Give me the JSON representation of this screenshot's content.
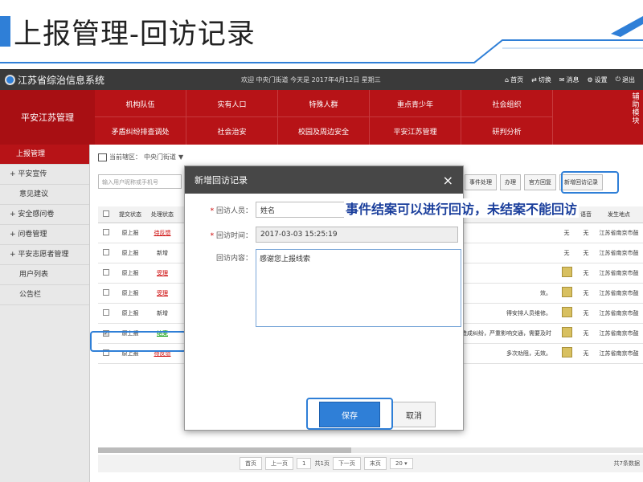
{
  "slide": {
    "title": "上报管理-回访记录",
    "annotation": "事件结案可以进行回访，未结案不能回访"
  },
  "topbar": {
    "logo": "江苏省综治信息系统",
    "welcome": "欢迎 中央门街道 今天是 2017年4月12日 星期三",
    "links": [
      {
        "icon": "home-icon",
        "label": "首页"
      },
      {
        "icon": "switch-icon",
        "label": "切换"
      },
      {
        "icon": "mail-icon",
        "label": "消息"
      },
      {
        "icon": "gear-icon",
        "label": "设置"
      },
      {
        "icon": "power-icon",
        "label": "退出"
      }
    ]
  },
  "nav": {
    "current": "平安江苏管理",
    "row1": [
      "机构队伍",
      "实有人口",
      "特殊人群",
      "重点青少年",
      "社会组织"
    ],
    "row2": [
      "矛盾纠纷排查调处",
      "社会治安",
      "校园及周边安全",
      "平安江苏管理",
      "研判分析"
    ],
    "side_module": "辅助模块"
  },
  "sidebar": {
    "items": [
      {
        "label": "上报管理",
        "active": true
      },
      {
        "label": "+ 平安宣传"
      },
      {
        "label": "意见建议",
        "sub": true
      },
      {
        "label": "+ 安全感问卷"
      },
      {
        "label": "+ 问卷管理"
      },
      {
        "label": "+ 平安志愿者管理"
      },
      {
        "label": "用户列表",
        "sub": true
      },
      {
        "label": "公告栏",
        "sub": true
      }
    ]
  },
  "main": {
    "crumb_prefix": "当前辖区：",
    "crumb_value": "中央门街道",
    "search_placeholder": "输入用户昵称或手机号",
    "actions": [
      "事件处理",
      "办理",
      "官方回复",
      "新增回访记录"
    ],
    "columns": [
      "",
      "提交状态",
      "处理状态",
      "图片",
      "语音",
      "发生地点"
    ],
    "rows": [
      {
        "submit": "原上报",
        "status": "待反馈",
        "status_type": "link",
        "desc": "",
        "pic": "无",
        "voice": "无",
        "place": "江苏省南京市鼓"
      },
      {
        "submit": "原上报",
        "status": "新增",
        "status_type": "plain",
        "desc": "",
        "pic": "无",
        "voice": "无",
        "place": "江苏省南京市鼓"
      },
      {
        "submit": "原上报",
        "status": "受理",
        "status_type": "link",
        "desc": "",
        "pic": "img",
        "voice": "无",
        "place": "江苏省南京市鼓"
      },
      {
        "submit": "原上报",
        "status": "受理",
        "status_type": "link",
        "desc": "效。",
        "pic": "img",
        "voice": "无",
        "place": "江苏省南京市鼓"
      },
      {
        "submit": "原上报",
        "status": "新增",
        "status_type": "plain",
        "desc": "得安排人员维修。",
        "pic": "img",
        "voice": "无",
        "place": "江苏省南京市鼓"
      },
      {
        "submit": "原上报",
        "status": "结案",
        "status_type": "green",
        "desc": "造成纠纷，严重影响交通，需要及时",
        "pic": "img",
        "voice": "无",
        "place": "江苏省南京市鼓",
        "checked": true
      },
      {
        "submit": "原上报",
        "status": "待反馈",
        "status_type": "link",
        "desc": "多次劝阻，无效。",
        "pic": "img",
        "voice": "无",
        "place": "江苏省南京市鼓"
      }
    ],
    "pager": {
      "first": "首页",
      "prev": "上一页",
      "page": "1",
      "total_pages": "共1页",
      "next": "下一页",
      "last": "末页",
      "page_size": "20",
      "total": "共7条数据"
    }
  },
  "modal": {
    "title": "新增回访记录",
    "close": "×",
    "visitor_label": "回访人员：",
    "visitor_value": "姓名",
    "time_label": "回访时间：",
    "time_value": "2017-03-03 15:25:19",
    "content_label": "回访内容：",
    "content_value": "感谢您上报线索",
    "save": "保存",
    "cancel": "取消"
  },
  "colors": {
    "red": "#b71317",
    "blue": "#2f7fd7",
    "dark": "#3a3a3a"
  }
}
